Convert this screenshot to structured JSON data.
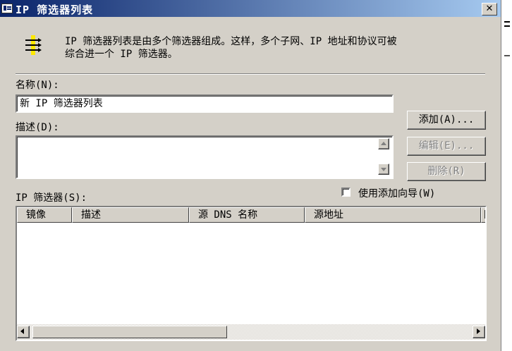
{
  "window": {
    "title": "IP 筛选器列表",
    "close_label": "✕"
  },
  "description": "IP 筛选器列表是由多个筛选器组成。这样，多个子网、IP 地址和协议可被\n综合进一个 IP 筛选器。",
  "name_field": {
    "label": "名称(N):",
    "value": "新 IP 筛选器列表"
  },
  "desc_field": {
    "label": "描述(D):",
    "value": ""
  },
  "buttons": {
    "add": "添加(A)...",
    "edit": "编辑(E)...",
    "remove": "删除(R)"
  },
  "filters": {
    "label": "IP 筛选器(S):",
    "wizard_checkbox": {
      "label": "使用添加向导(W)",
      "checked": false
    },
    "columns": [
      "镜像",
      "描述",
      "源 DNS 名称",
      "源地址",
      "目"
    ],
    "rows": []
  },
  "colors": {
    "titlebar_start": "#0a246a",
    "titlebar_end": "#a6caf0",
    "face": "#d4d0c8"
  }
}
